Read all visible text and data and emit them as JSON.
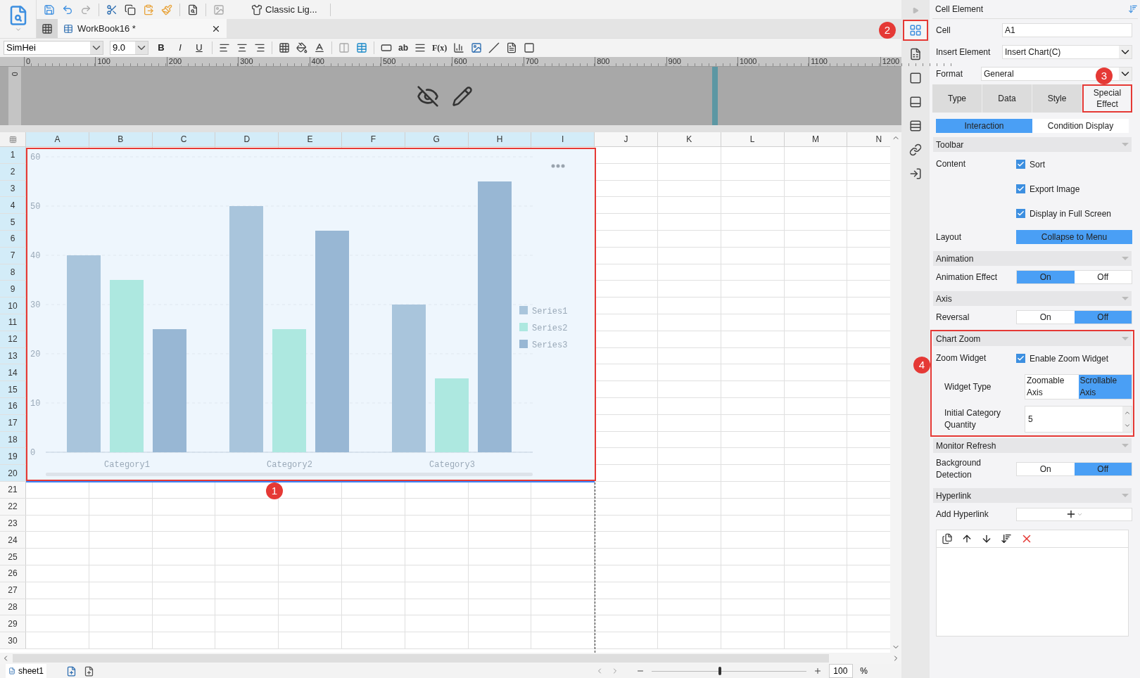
{
  "toolbar": {
    "theme_label": "Classic Lig..."
  },
  "tabs": [
    {
      "label": "WorkBook16 *",
      "selected": true
    }
  ],
  "format_bar": {
    "font": "SimHei",
    "size": "9.0",
    "styles": [
      "B",
      "I",
      "U"
    ],
    "labels": [
      "ab",
      "F(x)"
    ]
  },
  "ruler": {
    "side": "0",
    "ticks": [
      "0",
      "100",
      "200",
      "300",
      "400",
      "500",
      "600",
      "700",
      "800",
      "900",
      "1000",
      "1100",
      "1200"
    ]
  },
  "sheet": {
    "columns": [
      {
        "label": "A",
        "selected": true
      },
      {
        "label": "B",
        "selected": true
      },
      {
        "label": "C",
        "selected": true
      },
      {
        "label": "D",
        "selected": true
      },
      {
        "label": "E",
        "selected": true
      },
      {
        "label": "F",
        "selected": true
      },
      {
        "label": "G",
        "selected": true
      },
      {
        "label": "H",
        "selected": true
      },
      {
        "label": "I",
        "selected": true
      },
      {
        "label": "J",
        "selected": false
      },
      {
        "label": "K",
        "selected": false
      },
      {
        "label": "L",
        "selected": false
      },
      {
        "label": "M",
        "selected": false
      },
      {
        "label": "N",
        "selected": false
      }
    ],
    "rows": [
      {
        "label": "1",
        "selected": true
      },
      {
        "label": "2",
        "selected": true
      },
      {
        "label": "3",
        "selected": true
      },
      {
        "label": "4",
        "selected": true
      },
      {
        "label": "5",
        "selected": true
      },
      {
        "label": "6",
        "selected": true
      },
      {
        "label": "7",
        "selected": true
      },
      {
        "label": "8",
        "selected": true
      },
      {
        "label": "9",
        "selected": true
      },
      {
        "label": "10",
        "selected": true
      },
      {
        "label": "11",
        "selected": true
      },
      {
        "label": "12",
        "selected": true
      },
      {
        "label": "13",
        "selected": true
      },
      {
        "label": "14",
        "selected": true
      },
      {
        "label": "15",
        "selected": true
      },
      {
        "label": "16",
        "selected": true
      },
      {
        "label": "17",
        "selected": true
      },
      {
        "label": "18",
        "selected": true
      },
      {
        "label": "19",
        "selected": true
      },
      {
        "label": "20",
        "selected": true
      },
      {
        "label": "21",
        "selected": false
      },
      {
        "label": "22",
        "selected": false
      },
      {
        "label": "23",
        "selected": false
      },
      {
        "label": "24",
        "selected": false
      },
      {
        "label": "25",
        "selected": false
      },
      {
        "label": "26",
        "selected": false
      },
      {
        "label": "27",
        "selected": false
      },
      {
        "label": "28",
        "selected": false
      },
      {
        "label": "29",
        "selected": false
      },
      {
        "label": "30",
        "selected": false
      }
    ]
  },
  "chart": {
    "highlighted": true,
    "badge": "1",
    "chart_data": {
      "type": "bar",
      "categories": [
        "Category1",
        "Category2",
        "Category3"
      ],
      "series": [
        {
          "name": "Series1",
          "color": "#a9c5dc",
          "values": [
            40,
            50,
            30
          ]
        },
        {
          "name": "Series2",
          "color": "#ade8e0",
          "values": [
            35,
            25,
            15
          ]
        },
        {
          "name": "Series3",
          "color": "#98b7d4",
          "values": [
            25,
            45,
            55
          ]
        }
      ],
      "ylim": [
        0,
        60
      ],
      "yticks": [
        0,
        10,
        20,
        30,
        40,
        50,
        60
      ],
      "grid": true,
      "legend": true
    }
  },
  "side_icons": [
    {
      "selected": true,
      "highlighted": true,
      "badge": "2"
    },
    {
      "selected": false,
      "highlighted": false
    },
    {
      "selected": false,
      "highlighted": false
    },
    {
      "selected": false,
      "highlighted": false
    },
    {
      "selected": false,
      "highlighted": false
    },
    {
      "selected": false,
      "highlighted": false
    },
    {
      "selected": false,
      "highlighted": false
    }
  ],
  "panel": {
    "title": "Cell Element",
    "cell_label": "Cell",
    "cell_value": "A1",
    "insert_label": "Insert Element",
    "insert_value": "Insert Chart(C)",
    "format_label": "Format",
    "format_value": "General",
    "tabs": [
      {
        "label": "Type",
        "selected": false,
        "highlighted": false
      },
      {
        "label": "Data",
        "selected": false,
        "highlighted": false
      },
      {
        "label": "Style",
        "selected": false,
        "highlighted": false
      },
      {
        "label": "Special Effect",
        "selected": true,
        "highlighted": true,
        "badge": "3"
      }
    ],
    "subtabs": [
      {
        "label": "Interaction",
        "selected": true
      },
      {
        "label": "Condition Display",
        "selected": false
      }
    ],
    "sections": [
      {
        "title": "Toolbar",
        "highlighted": false,
        "rows": [
          {
            "kind": "checks",
            "label": "Content",
            "items": [
              {
                "label": "Sort",
                "checked": true
              },
              {
                "label": "Export Image",
                "checked": true
              },
              {
                "label": "Display in Full Screen",
                "checked": true
              }
            ]
          },
          {
            "kind": "button",
            "label": "Layout",
            "button": "Collapse to Menu"
          }
        ]
      },
      {
        "title": "Animation",
        "highlighted": false,
        "rows": [
          {
            "kind": "toggle",
            "label": "Animation Effect",
            "options": [
              {
                "label": "On",
                "selected": true
              },
              {
                "label": "Off",
                "selected": false
              }
            ]
          }
        ]
      },
      {
        "title": "Axis",
        "highlighted": false,
        "rows": [
          {
            "kind": "toggle",
            "label": "Reversal",
            "options": [
              {
                "label": "On",
                "selected": false
              },
              {
                "label": "Off",
                "selected": true
              }
            ]
          }
        ]
      },
      {
        "title": "Chart Zoom",
        "highlighted": true,
        "badge": "4",
        "rows": [
          {
            "kind": "checks",
            "label": "Zoom Widget",
            "items": [
              {
                "label": "Enable Zoom Widget",
                "checked": true
              }
            ],
            "children": [
              {
                "kind": "choice",
                "label": "Widget Type",
                "options": [
                  {
                    "label": "Zoomable Axis",
                    "selected": false
                  },
                  {
                    "label": "Scrollable Axis",
                    "selected": true
                  }
                ]
              },
              {
                "kind": "spinner",
                "label": "Initial Category Quantity",
                "value": "5"
              }
            ]
          }
        ]
      },
      {
        "title": "Monitor Refresh",
        "highlighted": false,
        "rows": [
          {
            "kind": "toggle",
            "label": "Background Detection",
            "options": [
              {
                "label": "On",
                "selected": false
              },
              {
                "label": "Off",
                "selected": true
              }
            ]
          }
        ]
      },
      {
        "title": "Hyperlink",
        "highlighted": false,
        "rows": [
          {
            "kind": "add",
            "label": "Add Hyperlink"
          },
          {
            "kind": "list"
          }
        ]
      }
    ]
  },
  "sheet_tabs": [
    {
      "label": "sheet1",
      "selected": true
    }
  ],
  "zoom": {
    "level": 0.45,
    "value": "100",
    "unit": "%"
  }
}
